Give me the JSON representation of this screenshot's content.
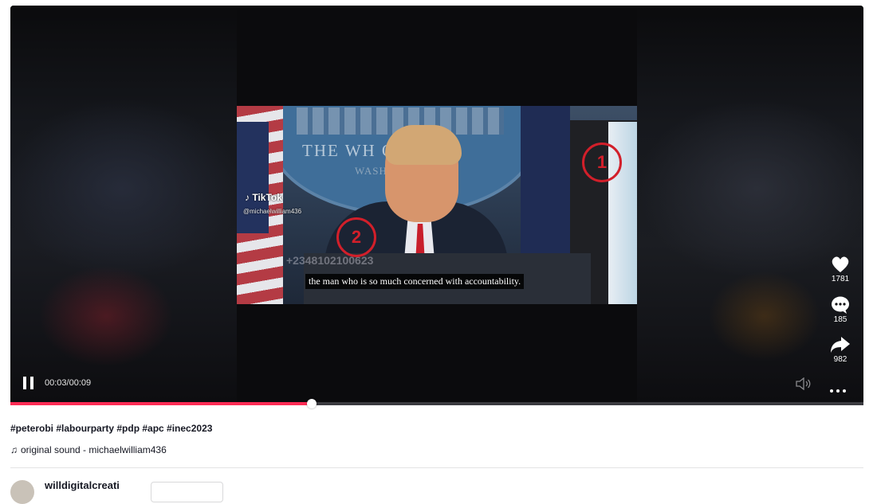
{
  "video": {
    "watermark_logo": "TikTok",
    "watermark_handle": "@michaelwilliam436",
    "overlay_phone": "+2348102100623",
    "subtitle": "the man who is so much concerned with accountability.",
    "seal_text": "THE WH    OUSE",
    "seal_subtext": "WASH",
    "annotations": [
      "1",
      "2"
    ]
  },
  "actions": {
    "likes": "1781",
    "comments": "185",
    "shares": "982"
  },
  "controls": {
    "time": "00:03/00:09",
    "progress_fraction": 0.353
  },
  "caption": {
    "hashtags": "#peterobi #labourparty #pdp #apc #inec2023",
    "sound_icon": "music-note-icon",
    "sound": "original sound - michaelwilliam436"
  },
  "author": {
    "name": "willdigitalcreati"
  },
  "colors": {
    "accent": "#fe2c55",
    "annotation": "#d21f2a"
  }
}
